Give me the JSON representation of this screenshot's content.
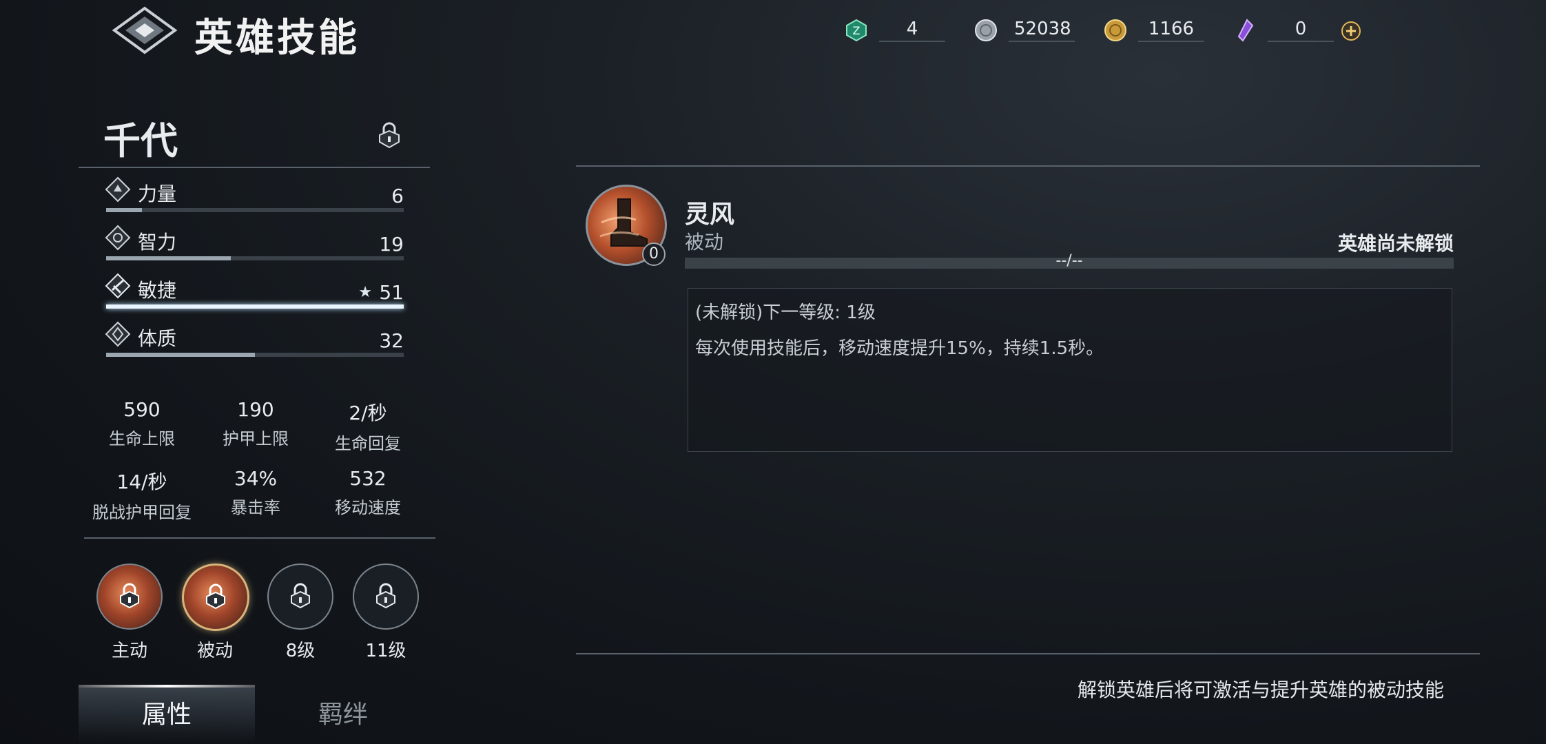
{
  "header": {
    "title": "英雄技能",
    "currencies": [
      {
        "icon": "energy-token-icon",
        "value": "4"
      },
      {
        "icon": "silver-coin-icon",
        "value": "52038"
      },
      {
        "icon": "gold-coin-icon",
        "value": "1166"
      },
      {
        "icon": "purple-crystal-icon",
        "value": "0"
      }
    ]
  },
  "hero": {
    "name": "千代",
    "stats": [
      {
        "icon": "strength-icon",
        "label": "力量",
        "value": "6",
        "fill": 0.12
      },
      {
        "icon": "intellect-icon",
        "label": "智力",
        "value": "19",
        "fill": 0.42
      },
      {
        "icon": "agility-icon",
        "label": "敏捷",
        "value": "51",
        "fill": 1.0,
        "starred": true
      },
      {
        "icon": "constitution-icon",
        "label": "体质",
        "value": "32",
        "fill": 0.5
      }
    ],
    "attributes": [
      {
        "value": "590",
        "label": "生命上限"
      },
      {
        "value": "190",
        "label": "护甲上限"
      },
      {
        "value": "2/秒",
        "label": "生命回复"
      },
      {
        "value": "14/秒",
        "label": "脱战护甲回复"
      },
      {
        "value": "34%",
        "label": "暴击率"
      },
      {
        "value": "532",
        "label": "移动速度"
      }
    ],
    "skills": [
      {
        "label": "主动",
        "state": "locked-art"
      },
      {
        "label": "被动",
        "state": "selected-art"
      },
      {
        "label": "8级",
        "state": "locked"
      },
      {
        "label": "11级",
        "state": "locked"
      }
    ],
    "tabs": [
      {
        "label": "属性",
        "active": true
      },
      {
        "label": "羁绊",
        "active": false
      }
    ]
  },
  "skill_detail": {
    "name": "灵风",
    "type": "被动",
    "level": "0",
    "status": "英雄尚未解锁",
    "progress_text": "--/--",
    "next_level": "(未解锁)下一等级: 1级",
    "description": "每次使用技能后，移动速度提升15%，持续1.5秒。",
    "footer_note": "解锁英雄后将可激活与提升英雄的被动技能"
  },
  "colors": {
    "background": "#161b20",
    "accent_gold": "#d8b57a",
    "divider": "#59616a"
  }
}
